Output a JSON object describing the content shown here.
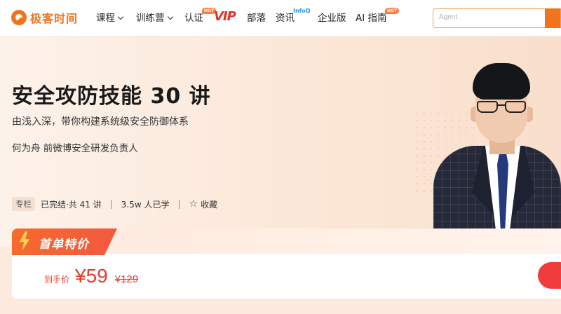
{
  "nav": {
    "logo": "极客时间",
    "items": [
      {
        "label": "课程",
        "dropdown": true
      },
      {
        "label": "训练营",
        "dropdown": true
      },
      {
        "label": "认证",
        "badge": "HOT"
      },
      {
        "label": "VIP"
      },
      {
        "label": "部落"
      },
      {
        "label": "资讯",
        "badge": "InfoQ"
      },
      {
        "label": "企业版"
      },
      {
        "label": "AI 指南",
        "badge": "HOT"
      }
    ],
    "search_placeholder": "Agent"
  },
  "course": {
    "title": "安全攻防技能 30 讲",
    "subtitle": "由浅入深，带你构建系统级安全防御体系",
    "author": "何为舟   前微博安全研发负责人",
    "tag": "专栏",
    "status": "已完结·共 41 讲",
    "learners": "3.5w 人已学",
    "sep": "|",
    "favorite": "收藏"
  },
  "price": {
    "promo": "首单特价",
    "label": "到手价",
    "current": "¥59",
    "original": "¥129"
  },
  "colors": {
    "accent": "#f2731d",
    "price": "#e83a2c",
    "vip": "#e3312d"
  },
  "icons": {
    "favorite": "star-outline-icon",
    "promo": "lightning-icon",
    "dropdown": "chevron-down-icon"
  }
}
